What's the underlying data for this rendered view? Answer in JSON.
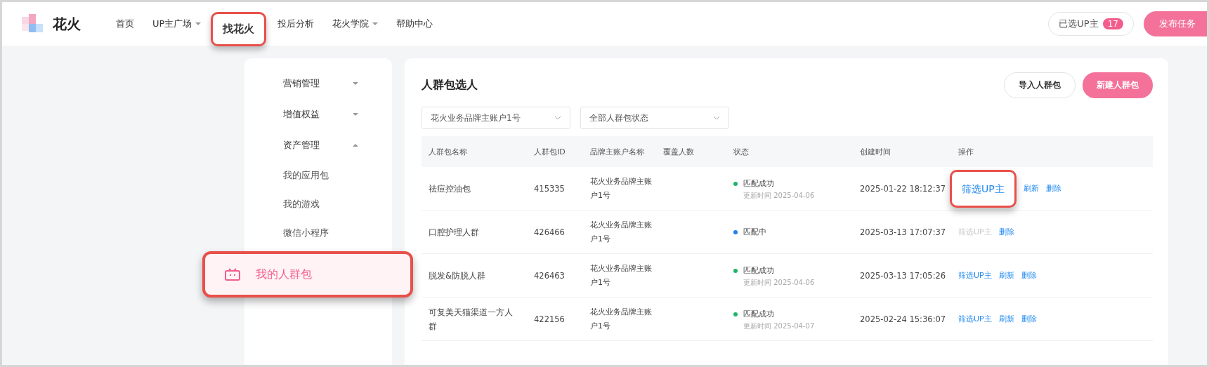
{
  "logo": {
    "text": "花火"
  },
  "nav": [
    {
      "label": "首页",
      "dropdown": false,
      "highlighted": false
    },
    {
      "label": "UP主广场",
      "dropdown": true,
      "highlighted": false
    },
    {
      "label": "找花火",
      "dropdown": false,
      "highlighted": true
    },
    {
      "label": "投后分析",
      "dropdown": false,
      "highlighted": false
    },
    {
      "label": "花火学院",
      "dropdown": true,
      "highlighted": false
    },
    {
      "label": "帮助中心",
      "dropdown": false,
      "highlighted": false
    }
  ],
  "selected_up": {
    "label": "已选UP主",
    "count": "17"
  },
  "publish_button": "发布任务",
  "sidebar": {
    "groups": [
      {
        "label": "营销管理",
        "expanded": false
      },
      {
        "label": "增值权益",
        "expanded": false
      },
      {
        "label": "资产管理",
        "expanded": true,
        "children": [
          {
            "label": "我的应用包",
            "selected": false,
            "highlighted": false
          },
          {
            "label": "我的游戏",
            "selected": false,
            "highlighted": false
          },
          {
            "label": "微信小程序",
            "selected": false,
            "highlighted": false
          },
          {
            "label": "我的人群包",
            "selected": true,
            "highlighted": true
          }
        ]
      }
    ]
  },
  "panel": {
    "title": "人群包选人",
    "import_button": "导入人群包",
    "new_button": "新建人群包",
    "filters": [
      {
        "value": "花火业务品牌主账户1号"
      },
      {
        "value": "全部人群包状态"
      }
    ]
  },
  "table": {
    "columns": [
      "人群包名称",
      "人群包ID",
      "品牌主账户名称",
      "覆盖人数",
      "状态",
      "创建时间",
      "操作"
    ],
    "rows": [
      {
        "name": "祛痘控油包",
        "id": "415335",
        "account": "花火业务品牌主账户1号",
        "status": {
          "text": "匹配成功",
          "color": "#1fb46b",
          "updated": "更新时间 2025-04-06"
        },
        "created": "2025-01-22 18:12:37",
        "actions": [
          {
            "label": "筛选UP主",
            "disabled": false,
            "highlighted": true
          },
          {
            "label": "刷新",
            "disabled": false,
            "highlighted": false
          },
          {
            "label": "删除",
            "disabled": false,
            "highlighted": false
          }
        ]
      },
      {
        "name": "口腔护理人群",
        "id": "426466",
        "account": "花火业务品牌主账户1号",
        "status": {
          "text": "匹配中",
          "color": "#1e7ef0"
        },
        "created": "2025-03-13 17:07:37",
        "actions": [
          {
            "label": "筛选UP主",
            "disabled": true,
            "highlighted": false
          },
          {
            "label": "删除",
            "disabled": false,
            "highlighted": false
          }
        ]
      },
      {
        "name": "脱发&防脱人群",
        "id": "426463",
        "account": "花火业务品牌主账户1号",
        "status": {
          "text": "匹配成功",
          "color": "#1fb46b",
          "updated": "更新时间 2025-04-06"
        },
        "created": "2025-03-13 17:05:26",
        "actions": [
          {
            "label": "筛选UP主",
            "disabled": false,
            "highlighted": false
          },
          {
            "label": "刷新",
            "disabled": false,
            "highlighted": false
          },
          {
            "label": "删除",
            "disabled": false,
            "highlighted": false
          }
        ]
      },
      {
        "name": "可复美天猫渠道一方人群",
        "id": "422156",
        "account": "花火业务品牌主账户1号",
        "status": {
          "text": "匹配成功",
          "color": "#1fb46b",
          "updated": "更新时间 2025-04-07"
        },
        "created": "2025-02-24 15:36:07",
        "actions": [
          {
            "label": "筛选UP主",
            "disabled": false,
            "highlighted": false
          },
          {
            "label": "刷新",
            "disabled": false,
            "highlighted": false
          },
          {
            "label": "删除",
            "disabled": false,
            "highlighted": false
          }
        ]
      }
    ]
  }
}
